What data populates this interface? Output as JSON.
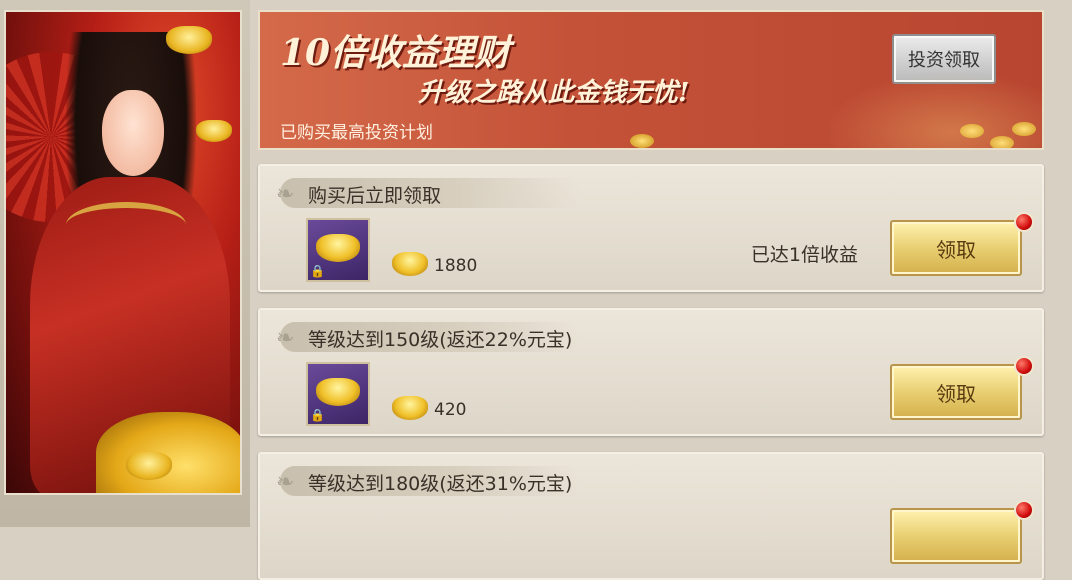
{
  "banner": {
    "title": "10倍收益理财",
    "subtitle": "升级之路从此金钱无忧!",
    "status": "已购买最高投资计划",
    "invest_button": "投资领取"
  },
  "rows": [
    {
      "title": "购买后立即领取",
      "amount": "1880",
      "status": "已达1倍收益",
      "claim": "领取"
    },
    {
      "title": "等级达到150级(返还22%元宝)",
      "amount": "420",
      "status": "",
      "claim": "领取"
    },
    {
      "title": "等级达到180级(返还31%元宝)",
      "amount": "",
      "status": "",
      "claim": ""
    }
  ],
  "colors": {
    "claim_button": "#e8cf72",
    "banner": "#c45238",
    "notification_dot": "#d10c0c"
  },
  "icons": [
    "gold-ingot-icon",
    "lock-icon",
    "notification-dot-icon",
    "swirl-icon"
  ]
}
